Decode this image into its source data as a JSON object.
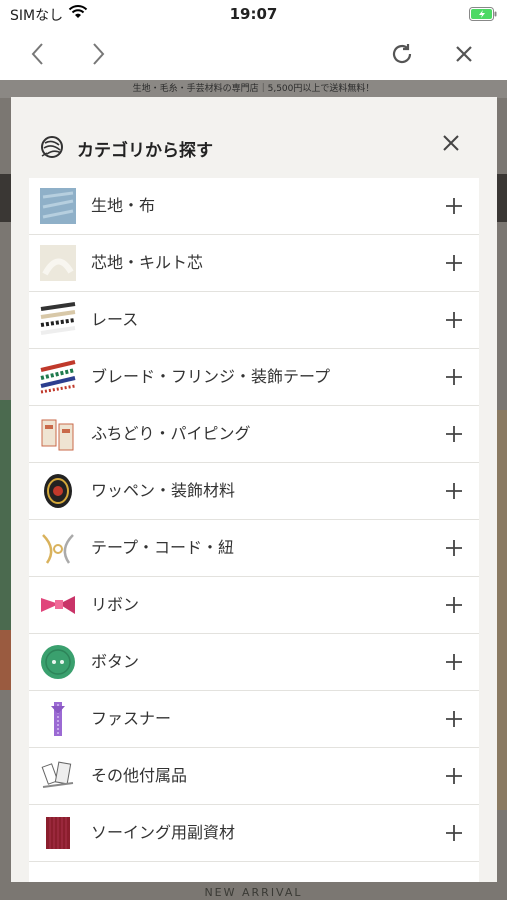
{
  "status_bar": {
    "carrier": "SIMなし",
    "time": "19:07"
  },
  "toolbar": {
    "back_icon": "chevron-left-icon",
    "forward_icon": "chevron-right-icon",
    "reload_icon": "reload-icon",
    "close_icon": "close-icon"
  },
  "background": {
    "banner_text": "生地・毛糸・手芸材料の専門店｜5,500円以上で送料無料！",
    "section_title": "NEW ARRIVAL"
  },
  "modal": {
    "title": "カテゴリから探す",
    "title_icon": "yarn-ball-icon",
    "close_icon": "close-icon",
    "categories": [
      {
        "label": "生地・布",
        "icon": "fabric-icon",
        "color": "#8fb0c8"
      },
      {
        "label": "芯地・キルト芯",
        "icon": "interlining-icon",
        "color": "#e8e3d6"
      },
      {
        "label": "レース",
        "icon": "lace-icon",
        "color": "#3a3a3a"
      },
      {
        "label": "ブレード・フリンジ・装飾テープ",
        "icon": "braid-icon",
        "color": "#c0392b"
      },
      {
        "label": "ふちどり・パイピング",
        "icon": "piping-icon",
        "color": "#c96a4a"
      },
      {
        "label": "ワッペン・装飾材料",
        "icon": "emblem-icon",
        "color": "#2a2a2a"
      },
      {
        "label": "テープ・コード・紐",
        "icon": "cord-icon",
        "color": "#d9b25c"
      },
      {
        "label": "リボン",
        "icon": "ribbon-icon",
        "color": "#e0457b"
      },
      {
        "label": "ボタン",
        "icon": "button-icon",
        "color": "#3aa06e"
      },
      {
        "label": "ファスナー",
        "icon": "zipper-icon",
        "color": "#9b6ad3"
      },
      {
        "label": "その他付属品",
        "icon": "accessories-icon",
        "color": "#a8a8a8"
      },
      {
        "label": "ソーイング用副資材",
        "icon": "sewing-supplies-icon",
        "color": "#8b1e2d"
      }
    ]
  }
}
